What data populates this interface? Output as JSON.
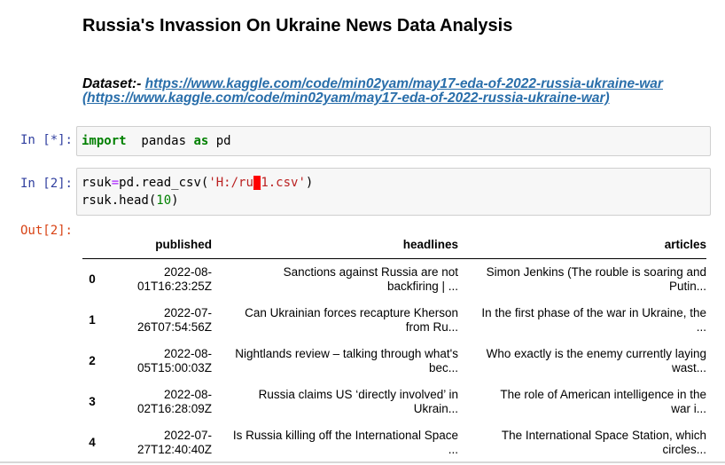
{
  "markdown": {
    "title": "Russia's Invassion On Ukraine News Data Analysis",
    "dataset_label": "Dataset:- ",
    "dataset_link": "https://www.kaggle.com/code/min02yam/may17-eda-of-2022-russia-ukraine-war",
    "dataset_link_paren": "(https://www.kaggle.com/code/min02yam/may17-eda-of-2022-russia-ukraine-war)"
  },
  "cells": [
    {
      "prompt": "In [*]:",
      "code_tokens": [
        [
          "kw",
          "import"
        ],
        [
          "",
          "  pandas "
        ],
        [
          "kw",
          "as"
        ],
        [
          "",
          " pd"
        ]
      ]
    },
    {
      "prompt": "In [2]:",
      "code_tokens": [
        [
          "",
          "rsuk"
        ],
        [
          "op",
          "="
        ],
        [
          "",
          "pd.read_csv("
        ],
        [
          "str",
          "'H:/ru"
        ],
        [
          "err",
          "_"
        ],
        [
          "str",
          "1.csv'"
        ],
        [
          "",
          ")\nrsuk.head("
        ],
        [
          "num",
          "10"
        ],
        [
          "",
          ")"
        ]
      ]
    }
  ],
  "output": {
    "prompt": "Out[2]:",
    "columns": [
      "",
      "published",
      "headlines",
      "articles"
    ],
    "rows": [
      {
        "index": "0",
        "published": [
          "2022-08-",
          "01T16:23:25Z"
        ],
        "headlines": [
          "Sanctions against Russia are not",
          "backfiring | ..."
        ],
        "articles": [
          "Simon Jenkins (The rouble is soaring and",
          "Putin..."
        ]
      },
      {
        "index": "1",
        "published": [
          "2022-07-",
          "26T07:54:56Z"
        ],
        "headlines": [
          "Can Ukrainian forces recapture Kherson",
          "from Ru..."
        ],
        "articles": [
          "In the first phase of the war in Ukraine, the",
          "..."
        ]
      },
      {
        "index": "2",
        "published": [
          "2022-08-",
          "05T15:00:03Z"
        ],
        "headlines": [
          "Nightlands review – talking through what's",
          "bec..."
        ],
        "articles": [
          "Who exactly is the enemy currently laying",
          "wast..."
        ]
      },
      {
        "index": "3",
        "published": [
          "2022-08-",
          "02T16:28:09Z"
        ],
        "headlines": [
          "Russia claims US ‘directly involved’ in",
          "Ukrain..."
        ],
        "articles": [
          "The role of American intelligence in the",
          "war i..."
        ]
      },
      {
        "index": "4",
        "published": [
          "2022-07-",
          "27T12:40:40Z"
        ],
        "headlines": [
          "Is Russia killing off the International Space",
          "..."
        ],
        "articles": [
          "The International Space Station, which",
          "circles..."
        ]
      }
    ]
  }
}
